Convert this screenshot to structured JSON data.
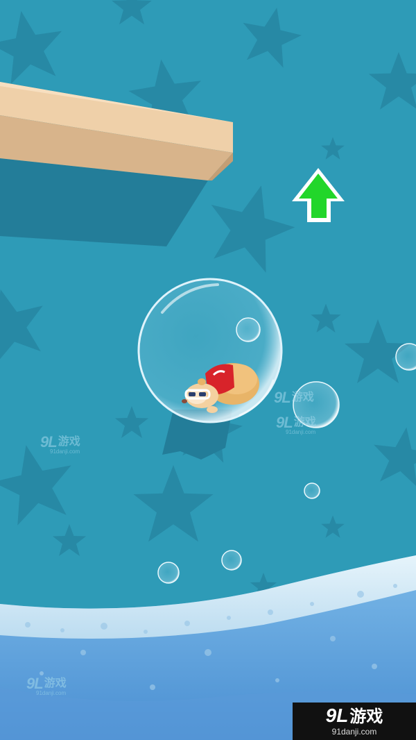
{
  "game": {
    "colors": {
      "water_bg": "#2e9bb7",
      "star_shape": "#2789a5",
      "plank_top": "#f2d3ae",
      "plank_front": "#d5b189",
      "arrow_fill": "#22d62a",
      "arrow_outline": "#ffffff",
      "foam": "#d8eef8",
      "pool": "#4a90d0"
    },
    "hud": {
      "direction_arrow": "up-arrow-icon"
    },
    "player": {
      "character": "hamster-in-bubble",
      "outfit_color": "#d8232a"
    }
  },
  "watermarks": {
    "brand_num": "9L",
    "brand_cn": "游戏",
    "domain": "91danji.com"
  },
  "corner_badge": {
    "num": "9L",
    "cn": "游戏",
    "domain": "91danji.com"
  }
}
